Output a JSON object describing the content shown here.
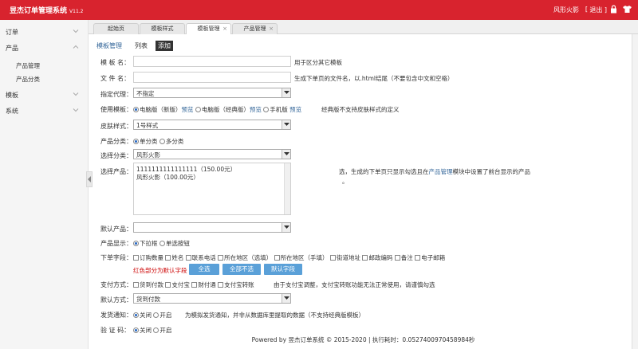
{
  "app": {
    "title": "昱杰订单管理系统",
    "version": "V11.2"
  },
  "topbar": {
    "user": "风形火影",
    "separator": "[",
    "logout": "退出 ]"
  },
  "sidebar": {
    "items": [
      {
        "label": "订单"
      },
      {
        "label": "产品",
        "children": [
          "产品管理",
          "产品分类"
        ]
      },
      {
        "label": "模板"
      },
      {
        "label": "系统"
      }
    ]
  },
  "tabs": [
    {
      "label": "起始页"
    },
    {
      "label": "模板样式"
    },
    {
      "label": "模板管理",
      "close": "×"
    },
    {
      "label": "产品管理",
      "close": "×"
    }
  ],
  "crumb": {
    "section": "模板管理",
    "list": "列表",
    "add": "添加"
  },
  "form": {
    "name": {
      "label": "模 板 名：",
      "value": "",
      "hint": "用于区分其它模板"
    },
    "file": {
      "label": "文 件 名：",
      "value": "",
      "hint": "生成下单页的文件名，以.html结尾（不要包含中文和空格）"
    },
    "agent": {
      "label": "指定代理：",
      "value": "不指定"
    },
    "template": {
      "label": "使用模板：",
      "opt1": "电脑版（新版）",
      "preview1": "预览",
      "opt2": "电脑版（经典版）",
      "preview2": "预览",
      "opt3": "手机版",
      "preview3": "预览",
      "hint": "经典版不支持皮肤样式的定义"
    },
    "skin": {
      "label": "皮肤样式：",
      "value": "1号样式"
    },
    "category_mode": {
      "label": "产品分类：",
      "opt1": "单分类",
      "opt2": "多分类"
    },
    "category": {
      "label": "选择分类：",
      "value": "风形火影"
    },
    "products": {
      "label": "选择产品：",
      "lines": [
        "1111111111111111（150.00元）",
        "风形火影（100.00元）"
      ],
      "hint_pre": "选，生成的下单页只显示勾选且在",
      "hint_link": "产品管理",
      "hint_post": "模块中设置了前台显示的产品",
      "hint2": "。"
    },
    "default_product": {
      "label": "默认产品：",
      "value": ""
    },
    "display": {
      "label": "产品显示：",
      "opt1": "下拉框",
      "opt2": "单选按钮"
    },
    "fields": {
      "label": "下单字段：",
      "items": [
        "订购数量",
        "姓名",
        "联系电话",
        "所在地区（选填）",
        "所在地区（手填）",
        "街道地址",
        "邮政编码",
        "备注",
        "电子邮箱"
      ],
      "red": "红色部分为默认字段",
      "btn_all": "全选",
      "btn_none": "全部不选",
      "btn_default": "默认字段"
    },
    "pay": {
      "label": "支付方式：",
      "items": [
        "货到付款",
        "支付宝",
        "财付通",
        "支付宝转账"
      ],
      "hint": "由于支付宝调整，支付宝转账功能无法正常使用，请谨慎勾选"
    },
    "default_pay": {
      "label": "默认方式：",
      "value": "货到付款"
    },
    "notify": {
      "label": "发货通知：",
      "opt1": "关闭",
      "opt2": "开启",
      "hint": "为模拟发货通知，并非从数据库里提取的数据（不支持经典版模板）"
    },
    "captcha": {
      "label": "验 证 码：",
      "opt1": "关闭",
      "opt2": "开启"
    }
  },
  "footer": "Powered by 昱杰订单系统 © 2015-2020   |   执行耗时：0.0527400970458984秒"
}
